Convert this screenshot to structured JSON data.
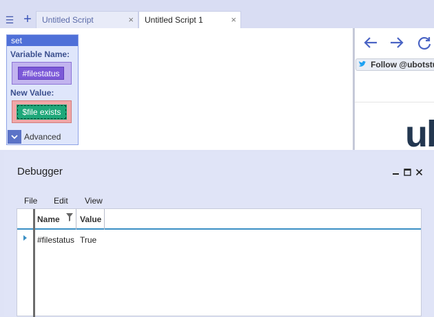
{
  "tabs": [
    {
      "label": "Untitled Script",
      "close": "×"
    },
    {
      "label": "Untitled Script 1",
      "close": "×"
    }
  ],
  "toolbar": {
    "menu_icon": "☰",
    "add_icon": "+"
  },
  "set_block": {
    "title": "set",
    "variable_name_label": "Variable Name:",
    "variable_value": "#filestatus",
    "new_value_label": "New Value:",
    "new_value": "$file exists",
    "advanced_label": "Advanced"
  },
  "browser": {
    "follow_label": "Follow @ubotstu",
    "logo_text": "ub"
  },
  "debugger": {
    "title": "Debugger",
    "menu": [
      "File",
      "Edit",
      "View"
    ],
    "columns": [
      "Name",
      "Value"
    ],
    "rows": [
      {
        "name": "#filestatus",
        "value": "True"
      }
    ]
  },
  "colors": {
    "block_header": "#4f70d8",
    "variable_chip": "#7c59d8",
    "value_chip": "#1fa87a",
    "accent": "#3a8fc4"
  }
}
